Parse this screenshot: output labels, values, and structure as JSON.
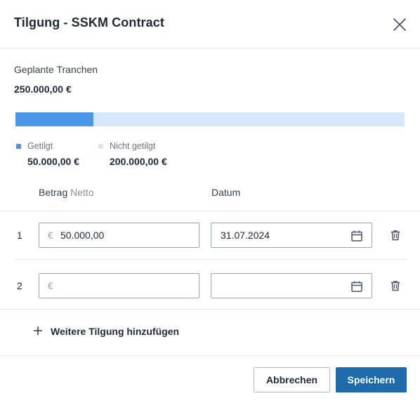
{
  "dialog": {
    "title": "Tilgung - SSKM Contract"
  },
  "summary": {
    "planned_label": "Geplante Tranchen",
    "planned_value": "250.000,00 €",
    "progress_fraction": 0.2,
    "colors": {
      "paid": "#4a95e8",
      "unpaid": "#d6e6fb"
    },
    "legend": [
      {
        "label": "Getilgt",
        "value": "50.000,00 €"
      },
      {
        "label": "Nicht getilgt",
        "value": "200.000,00 €"
      }
    ]
  },
  "table": {
    "columns": {
      "amount_label": "Betrag",
      "amount_suffix": "Netto",
      "date_label": "Datum"
    },
    "rows": [
      {
        "index": "1",
        "currency": "€",
        "amount": "50.000,00",
        "date": "31.07.2024"
      },
      {
        "index": "2",
        "currency": "€",
        "amount": "",
        "date": ""
      }
    ]
  },
  "actions": {
    "add_label": "Weitere Tilgung hinzufügen",
    "cancel_label": "Abbrechen",
    "save_label": "Speichern"
  }
}
